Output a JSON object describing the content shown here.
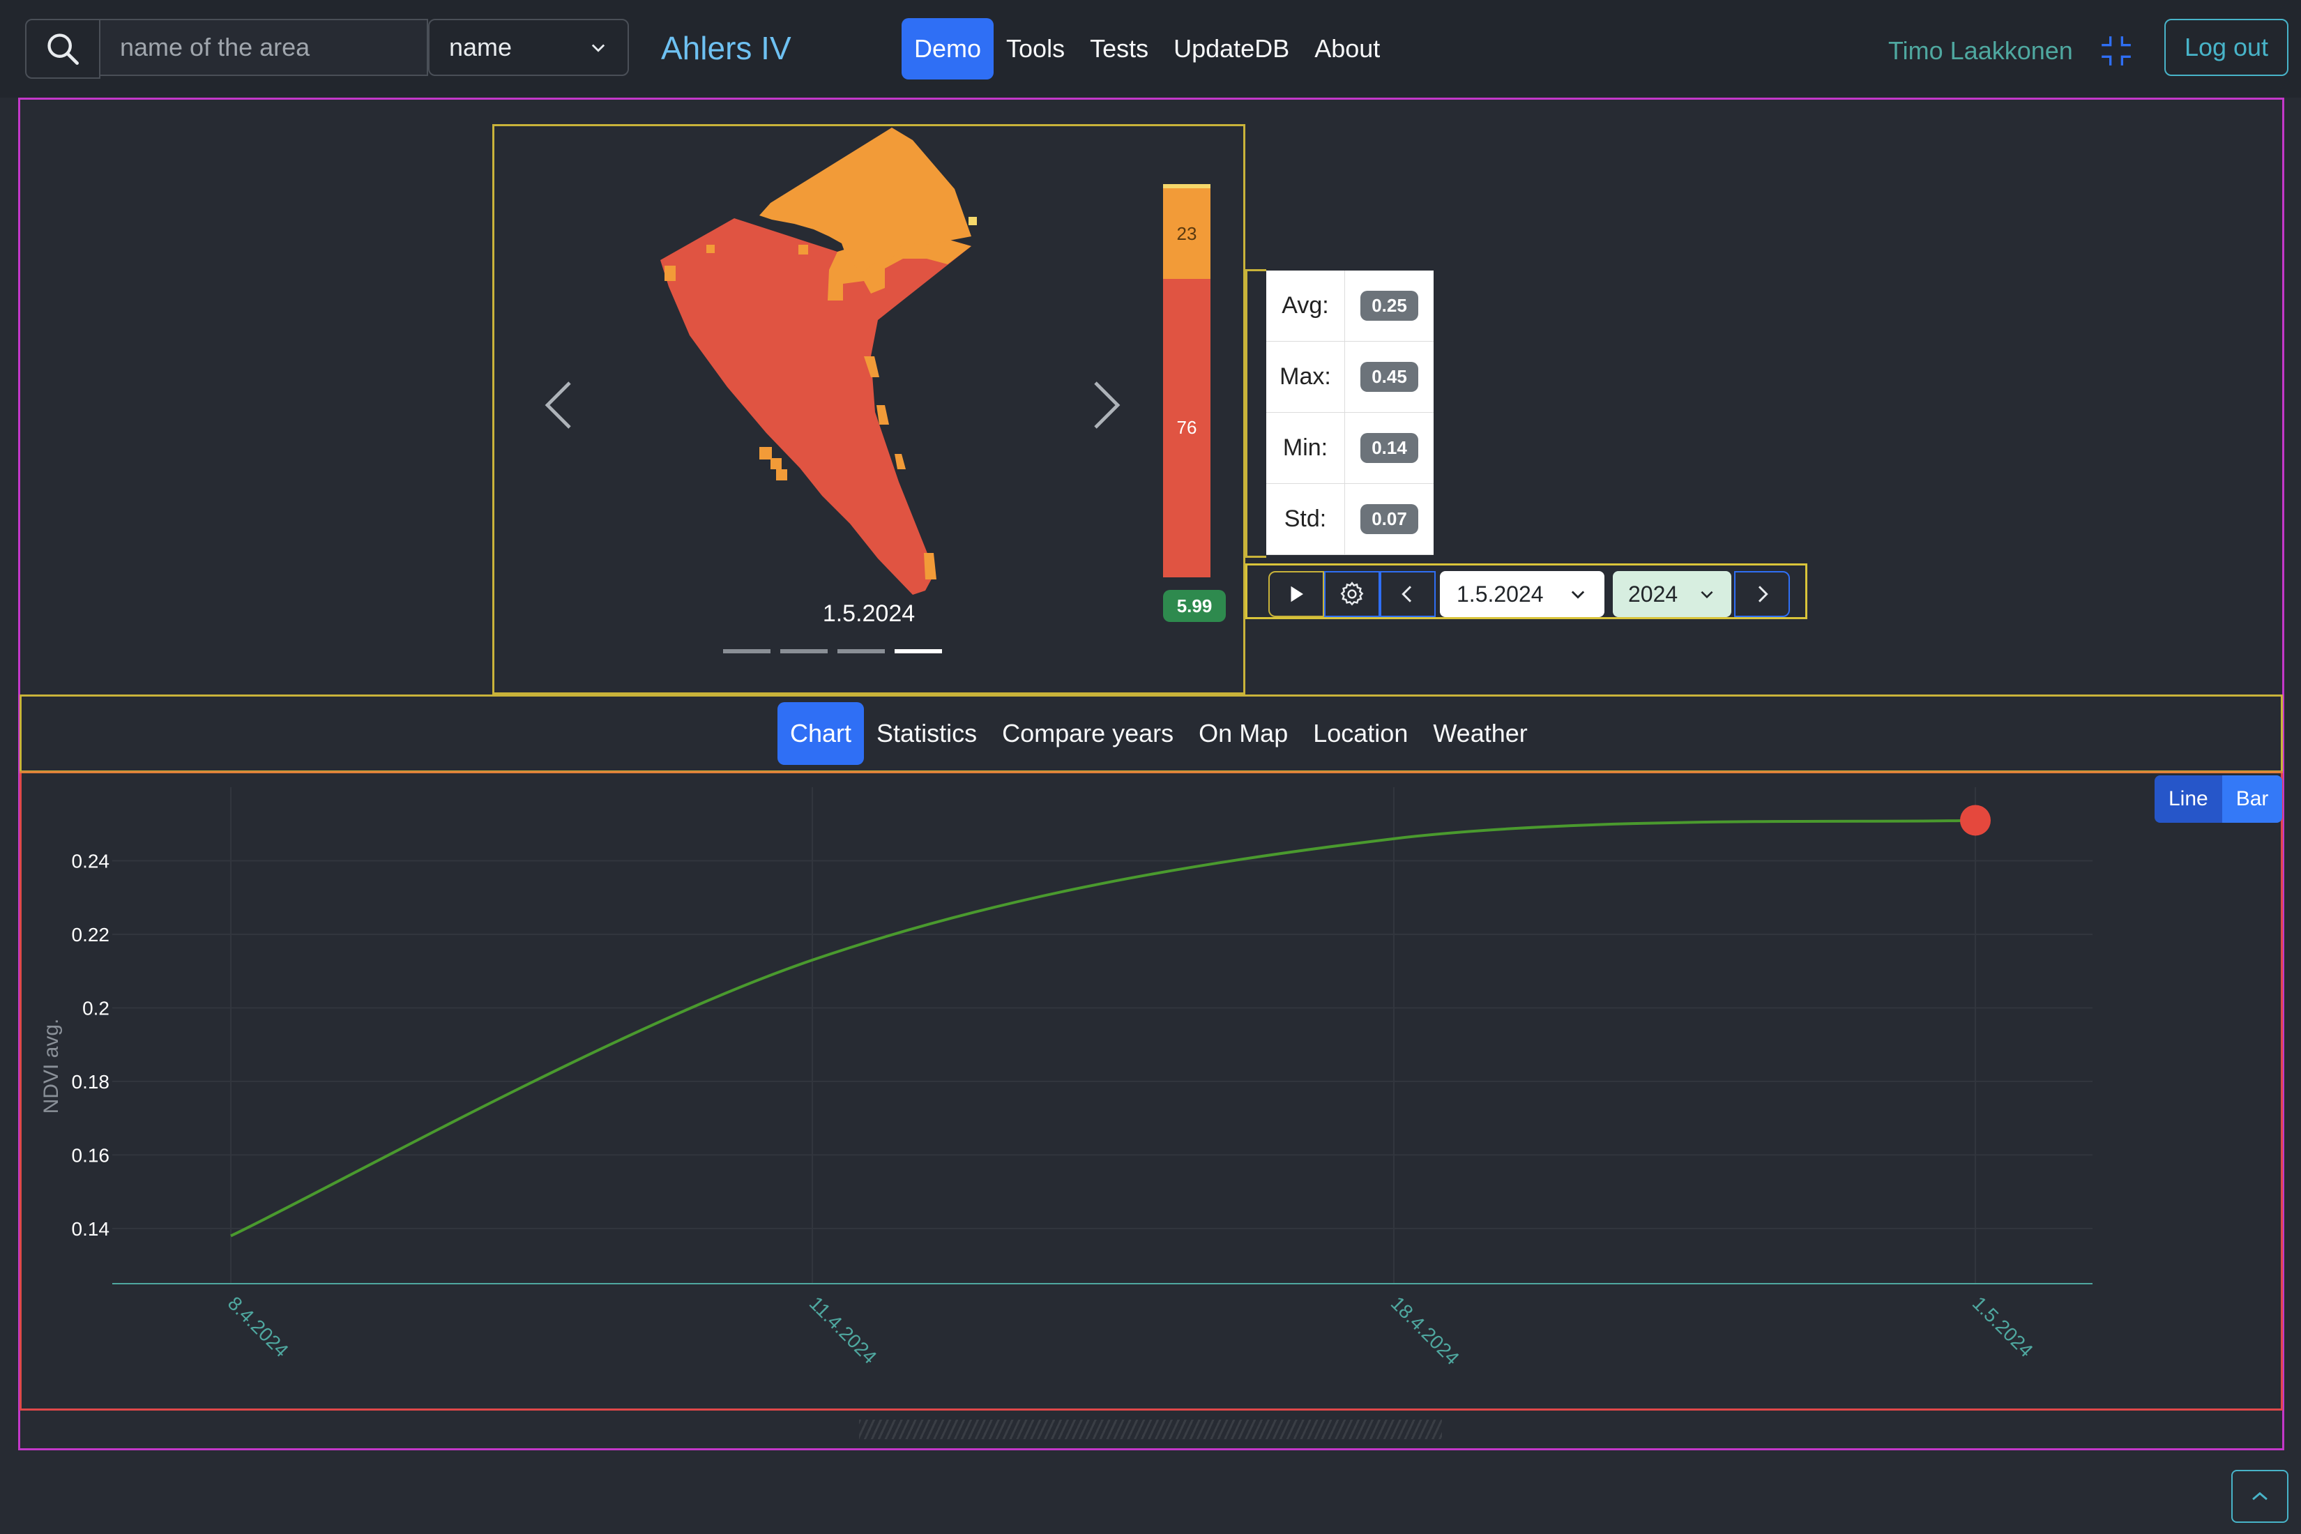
{
  "navbar": {
    "search_placeholder": "name of the area",
    "select_value": "name",
    "brand": "Ahlers IV",
    "links": [
      "Demo",
      "Tools",
      "Tests",
      "UpdateDB",
      "About"
    ],
    "active_link": "Demo",
    "user_name": "Timo Laakkonen",
    "logout_label": "Log out"
  },
  "carousel": {
    "date_caption": "1.5.2024",
    "indicator_count": 4,
    "active_indicator": 4
  },
  "legend": {
    "upper_value": "23",
    "lower_value": "76",
    "badge": "5.99",
    "colors": {
      "upper": "#f29b38",
      "lower": "#e05442",
      "top_sliver": "#f5d86b"
    }
  },
  "stats": [
    {
      "label": "Avg:",
      "value": "0.25"
    },
    {
      "label": "Max:",
      "value": "0.45"
    },
    {
      "label": "Min:",
      "value": "0.14"
    },
    {
      "label": "Std:",
      "value": "0.07"
    }
  ],
  "controls": {
    "date_value": "1.5.2024",
    "year_value": "2024",
    "icons": [
      "play-icon",
      "gear-icon",
      "chevron-left-icon",
      "chevron-right-icon"
    ]
  },
  "tabs": [
    "Chart",
    "Statistics",
    "Compare years",
    "On Map",
    "Location",
    "Weather"
  ],
  "active_tab": "Chart",
  "chart_toggle": {
    "line_label": "Line",
    "bar_label": "Bar",
    "active": "Bar"
  },
  "chart_data": {
    "type": "line",
    "ylabel": "NDVI avg.",
    "xlabel": "",
    "x": [
      "8.4.2024",
      "11.4.2024",
      "18.4.2024",
      "1.5.2024"
    ],
    "series": [
      {
        "values": [
          0.138,
          0.213,
          0.246,
          0.251
        ],
        "color": "#4a9a2e"
      }
    ],
    "yticks": [
      0.14,
      0.16,
      0.18,
      0.2,
      0.22,
      0.24
    ],
    "ytick_labels": [
      "0.14",
      "0.16",
      "0.18",
      "0.2",
      "0.22",
      "0.24"
    ],
    "ylim": [
      0.125,
      0.26
    ],
    "highlight_point": {
      "x": "1.5.2024",
      "y": 0.251,
      "color": "#e5483d"
    },
    "grid": true
  },
  "colors": {
    "accent": "#2f6ff5",
    "brand": "#6ec1f2",
    "field_high": "#f29b38",
    "field_low": "#e05442"
  }
}
